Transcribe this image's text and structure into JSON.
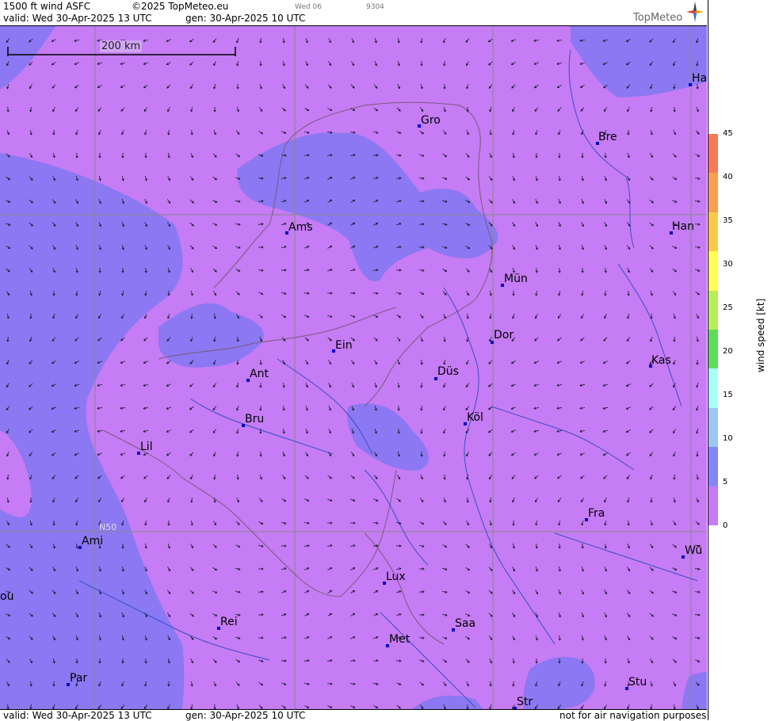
{
  "header": {
    "product": "1500 ft wind ASFC",
    "copyright": "©2025 TopMeteo.eu",
    "valid": "valid:  Wed  30-Apr-2025  13 UTC",
    "generated": "gen: 30-Apr-2025 10 UTC",
    "small_day": "Wed 06",
    "small_code": "9304",
    "brand": "TopMeteo"
  },
  "footer": {
    "valid": "valid:  Wed  30-Apr-2025  13 UTC",
    "generated": "gen: 30-Apr-2025 10 UTC",
    "disclaimer": "not for air navigation purposes"
  },
  "scale_bar": {
    "label": "200 km"
  },
  "grid_label": "N50",
  "colorbar": {
    "title": "wind  speed  [kt]",
    "ticks": [
      "45",
      "40",
      "35",
      "30",
      "25",
      "20",
      "15",
      "10",
      "5",
      "0"
    ],
    "colors": [
      "#f57a5a",
      "#f7a050",
      "#fbc94a",
      "#ffff55",
      "#b6ee5a",
      "#5ddc5a",
      "#a8fff7",
      "#9dc6f3",
      "#8586f5",
      "#c67af5"
    ]
  },
  "cities": [
    {
      "name": "Ha",
      "label": "Ha"
    },
    {
      "name": "Gro",
      "label": "Gro"
    },
    {
      "name": "Bre",
      "label": "Bre"
    },
    {
      "name": "Ams",
      "label": "Ams"
    },
    {
      "name": "Han",
      "label": "Han"
    },
    {
      "name": "Mün",
      "label": "Mün"
    },
    {
      "name": "Ein",
      "label": "Ein"
    },
    {
      "name": "Dor",
      "label": "Dor"
    },
    {
      "name": "Kas",
      "label": "Kas"
    },
    {
      "name": "Ant",
      "label": "Ant"
    },
    {
      "name": "Düs",
      "label": "Düs"
    },
    {
      "name": "Bru",
      "label": "Bru"
    },
    {
      "name": "Köl",
      "label": "Köl"
    },
    {
      "name": "Lil",
      "label": "Lil"
    },
    {
      "name": "Fra",
      "label": "Fra"
    },
    {
      "name": "Ami",
      "label": "Ami"
    },
    {
      "name": "Wü",
      "label": "Wü"
    },
    {
      "name": "Lux",
      "label": "Lux"
    },
    {
      "name": "ou",
      "label": "ou"
    },
    {
      "name": "Rei",
      "label": "Rei"
    },
    {
      "name": "Saa",
      "label": "Saa"
    },
    {
      "name": "Met",
      "label": "Met"
    },
    {
      "name": "Par",
      "label": "Par"
    },
    {
      "name": "Stu",
      "label": "Stu"
    },
    {
      "name": "Str",
      "label": "Str"
    }
  ]
}
